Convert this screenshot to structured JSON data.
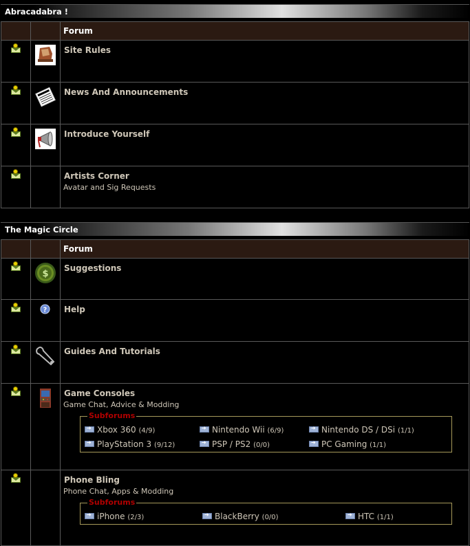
{
  "categories": [
    {
      "title": "Abracadabra !",
      "header": "Forum",
      "forums": [
        {
          "title": "Site Rules",
          "desc": "",
          "icon": "site-rules-icon"
        },
        {
          "title": "News And Announcements",
          "desc": "",
          "icon": "newspaper-icon"
        },
        {
          "title": "Introduce Yourself",
          "desc": "",
          "icon": "megaphone-icon"
        },
        {
          "title": "Artists Corner",
          "desc": "Avatar and Sig Requests",
          "icon": ""
        }
      ]
    },
    {
      "title": "The Magic Circle",
      "header": "Forum",
      "forums": [
        {
          "title": "Suggestions",
          "desc": "",
          "icon": "green-coin-icon"
        },
        {
          "title": "Help",
          "desc": "",
          "icon": "help-icon"
        },
        {
          "title": "Guides And Tutorials",
          "desc": "",
          "icon": "wrench-icon"
        },
        {
          "title": "Game Consoles",
          "desc": "Game Chat, Advice & Modding",
          "icon": "arcade-cabinet-icon",
          "subforums_label": "Subforums",
          "subforums": [
            {
              "name": "Xbox 360",
              "count": "(4/9)"
            },
            {
              "name": "Nintendo Wii",
              "count": "(6/9)"
            },
            {
              "name": "Nintendo DS / DSi",
              "count": "(1/1)"
            },
            {
              "name": "PlayStation 3",
              "count": "(9/12)"
            },
            {
              "name": "PSP / PS2",
              "count": "(0/0)"
            },
            {
              "name": "PC Gaming",
              "count": "(1/1)"
            }
          ]
        },
        {
          "title": "Phone Bling",
          "desc": "Phone Chat, Apps & Modding",
          "icon": "",
          "subforums_label": "Subforums",
          "subforums": [
            {
              "name": "iPhone",
              "count": "(2/3)"
            },
            {
              "name": "BlackBerry",
              "count": "(0/0)"
            },
            {
              "name": "HTC",
              "count": "(1/1)"
            }
          ]
        }
      ]
    }
  ]
}
